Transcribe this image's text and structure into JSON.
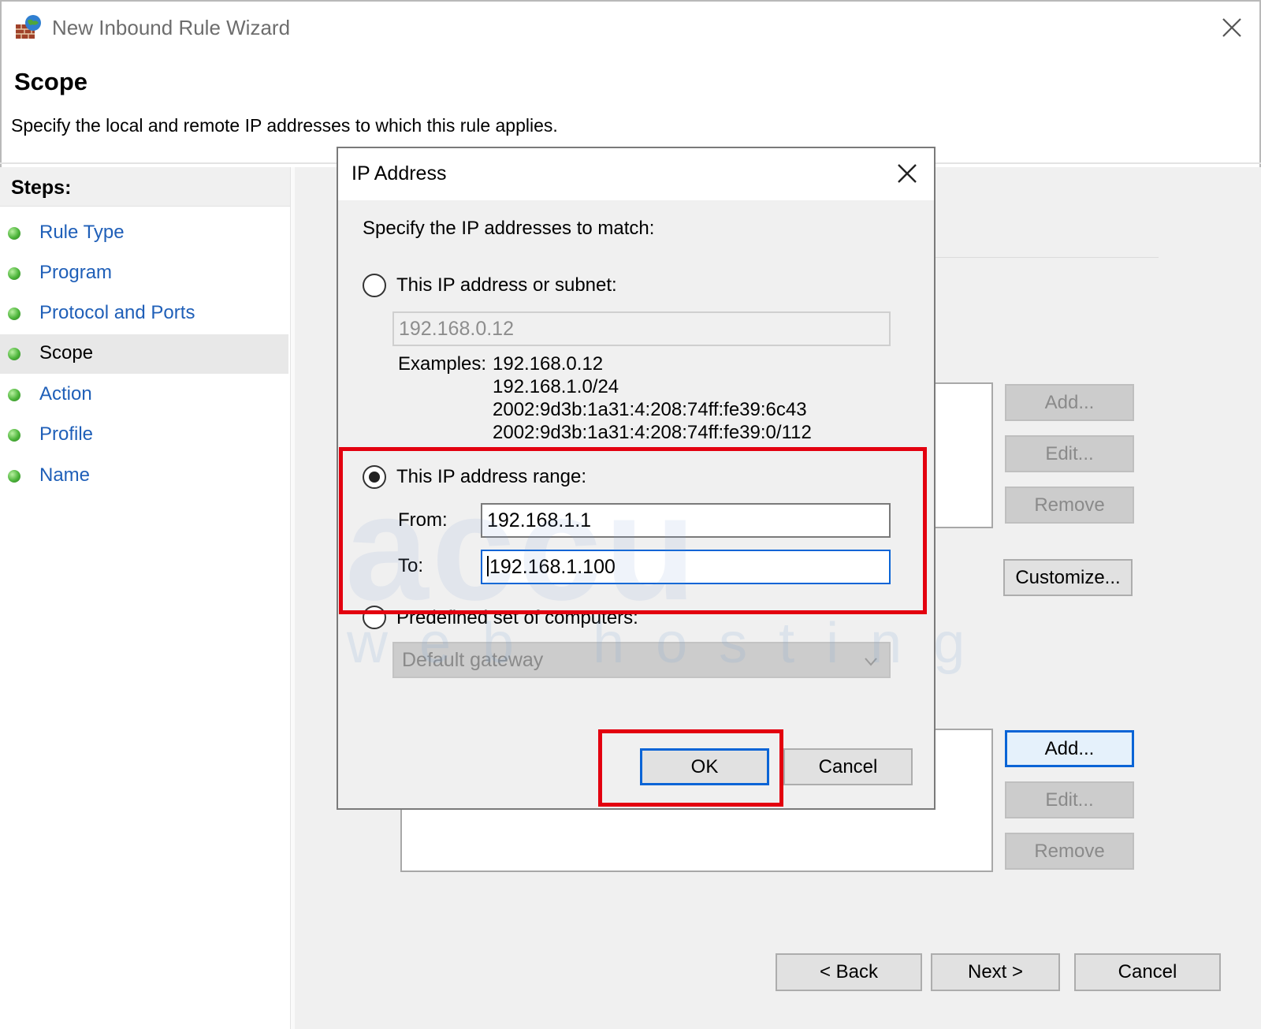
{
  "window": {
    "title": "New Inbound Rule Wizard",
    "page_heading": "Scope",
    "page_description": "Specify the local and remote IP addresses to which this rule applies."
  },
  "steps": {
    "title": "Steps:",
    "items": [
      {
        "label": "Rule Type",
        "active": false
      },
      {
        "label": "Program",
        "active": false
      },
      {
        "label": "Protocol and Ports",
        "active": false
      },
      {
        "label": "Scope",
        "active": true
      },
      {
        "label": "Action",
        "active": false
      },
      {
        "label": "Profile",
        "active": false
      },
      {
        "label": "Name",
        "active": false
      }
    ]
  },
  "local_buttons": {
    "add": "Add...",
    "edit": "Edit...",
    "remove": "Remove"
  },
  "customize_label": "Customize...",
  "remote_buttons": {
    "add": "Add...",
    "edit": "Edit...",
    "remove": "Remove"
  },
  "nav": {
    "back": "< Back",
    "next": "Next >",
    "cancel": "Cancel"
  },
  "dialog": {
    "title": "IP Address",
    "prompt": "Specify the IP addresses to match:",
    "subnet_option": {
      "label": "This IP address or subnet:",
      "selected": false,
      "value": "192.168.0.12"
    },
    "examples_label": "Examples:",
    "examples": [
      "192.168.0.12",
      "192.168.1.0/24",
      "2002:9d3b:1a31:4:208:74ff:fe39:6c43",
      "2002:9d3b:1a31:4:208:74ff:fe39:0/112"
    ],
    "range_option": {
      "label": "This IP address range:",
      "selected": true,
      "from_label": "From:",
      "from_value": "192.168.1.1",
      "to_label": "To:",
      "to_value": "192.168.1.100"
    },
    "predefined_option": {
      "label": "Predefined set of computers:",
      "selected": false,
      "combo_value": "Default gateway"
    },
    "ok": "OK",
    "cancel": "Cancel"
  },
  "watermark": {
    "big": "accu",
    "small": "web hosting"
  },
  "colors": {
    "highlight": "#e3000f",
    "focus": "#0a64d6",
    "link": "#1f5fb8",
    "step_dot": "#4cb43a"
  },
  "icons": [
    "firewall-icon",
    "close-icon",
    "step-bullet-icon",
    "chevron-down-icon"
  ]
}
